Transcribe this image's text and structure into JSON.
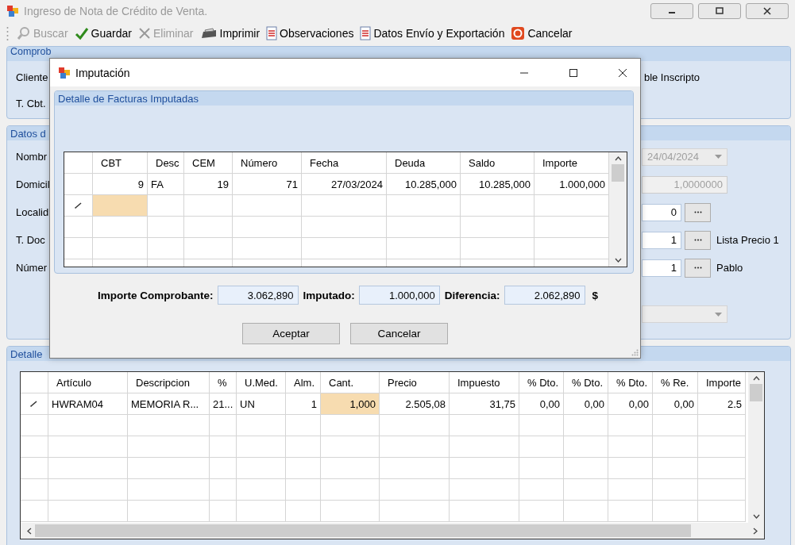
{
  "window": {
    "title": "Ingreso de Nota de Crédito de Venta."
  },
  "toolbar": [
    {
      "kind": "search",
      "label": "Buscar",
      "disabled": true
    },
    {
      "kind": "save",
      "label": "Guardar",
      "disabled": false
    },
    {
      "kind": "delete",
      "label": "Eliminar",
      "disabled": true
    },
    {
      "kind": "print",
      "label": "Imprimir",
      "disabled": false
    },
    {
      "kind": "document",
      "label": "Observaciones",
      "disabled": false
    },
    {
      "kind": "document",
      "label": "Datos Envío y Exportación",
      "disabled": false
    },
    {
      "kind": "cancel",
      "label": "Cancelar",
      "disabled": false
    }
  ],
  "comprobante": {
    "title": "Comprob",
    "labels": [
      "Cliente",
      "T. Cbt."
    ],
    "condition": "ble Inscripto"
  },
  "datos": {
    "title": "Datos d",
    "rows": [
      {
        "label": "Nombr",
        "kind": "date",
        "value": "24/04/2024",
        "disabled": true
      },
      {
        "label": "Domicil",
        "kind": "field",
        "value": "1,0000000",
        "disabled": true
      },
      {
        "label": "Localid",
        "kind": "lookup",
        "value": "0",
        "disabled": false
      },
      {
        "label": "T. Doc",
        "kind": "lookup",
        "value": "1",
        "note": "Lista Precio 1",
        "disabled": false
      },
      {
        "label": "Númer",
        "kind": "lookup",
        "value": "1",
        "note": "Pablo",
        "disabled": false
      },
      {
        "kind": "combo",
        "disabled": true
      }
    ]
  },
  "articulos": {
    "title": "Detalle",
    "columns": [
      {
        "label": "Artículo",
        "kind": "text"
      },
      {
        "label": "Descripcion",
        "kind": "text"
      },
      {
        "label": "%",
        "kind": "text"
      },
      {
        "label": "U.Med.",
        "kind": "text"
      },
      {
        "label": "Alm.",
        "kind": "number"
      },
      {
        "label": "Cant.",
        "kind": "number"
      },
      {
        "label": "Precio",
        "kind": "number"
      },
      {
        "label": "Impuesto",
        "kind": "number"
      },
      {
        "label": "% Dto.",
        "kind": "number"
      },
      {
        "label": "% Dto.",
        "kind": "number"
      },
      {
        "label": "% Dto.",
        "kind": "number"
      },
      {
        "label": "% Re.",
        "kind": "number"
      },
      {
        "label": "Importe",
        "kind": "number"
      }
    ],
    "rows": [
      {
        "editing": true,
        "cells": [
          {
            "text": "HWRAM04",
            "selected": false
          },
          {
            "text": "MEMORIA R...",
            "selected": false
          },
          {
            "text": "21...",
            "selected": false
          },
          {
            "text": "UN",
            "selected": false
          },
          {
            "text": "1",
            "selected": false
          },
          {
            "text": "1,000",
            "selected": true
          },
          {
            "text": "2.505,08",
            "selected": false
          },
          {
            "text": "31,75",
            "selected": false
          },
          {
            "text": "0,00",
            "selected": false
          },
          {
            "text": "0,00",
            "selected": false
          },
          {
            "text": "0,00",
            "selected": false
          },
          {
            "text": "0,00",
            "selected": false
          },
          {
            "text": "2.5",
            "selected": false
          }
        ]
      }
    ]
  },
  "dialog": {
    "title": "Imputación",
    "group": "Detalle de Facturas Imputadas",
    "columns": [
      {
        "label": "CBT",
        "kind": "number"
      },
      {
        "label": "Desc",
        "kind": "text"
      },
      {
        "label": "CEM",
        "kind": "number"
      },
      {
        "label": "Número",
        "kind": "number"
      },
      {
        "label": "Fecha",
        "kind": "number"
      },
      {
        "label": "Deuda",
        "kind": "number"
      },
      {
        "label": "Saldo",
        "kind": "number"
      },
      {
        "label": "Importe",
        "kind": "number"
      }
    ],
    "rows": [
      {
        "editing": false,
        "cells": [
          {
            "text": "9",
            "selected": false
          },
          {
            "text": "FA",
            "selected": false
          },
          {
            "text": "19",
            "selected": false
          },
          {
            "text": "71",
            "selected": false
          },
          {
            "text": "27/03/2024",
            "selected": false
          },
          {
            "text": "10.285,000",
            "selected": false
          },
          {
            "text": "10.285,000",
            "selected": false
          },
          {
            "text": "1.000,000",
            "selected": false
          }
        ]
      },
      {
        "editing": true,
        "cells": [
          {
            "selected": true
          }
        ]
      }
    ],
    "totals": [
      {
        "label": "Importe Comprobante:",
        "value": "3.062,890"
      },
      {
        "label": "Imputado:",
        "value": "1.000,000"
      },
      {
        "label": "Diferencia:",
        "value": "2.062,890"
      }
    ],
    "currency": "$",
    "buttons": [
      "Aceptar",
      "Cancelar"
    ]
  }
}
